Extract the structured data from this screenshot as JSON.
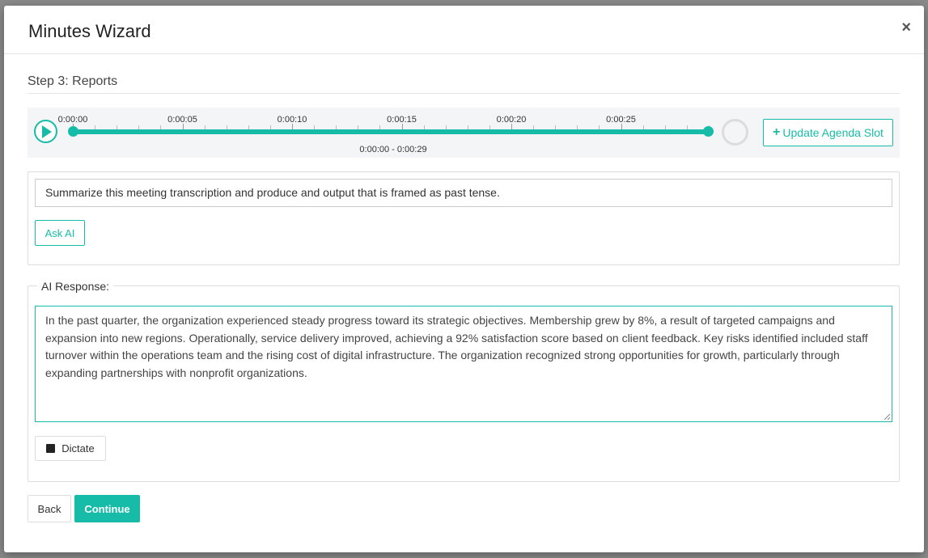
{
  "modal": {
    "title": "Minutes Wizard",
    "close_label": "×"
  },
  "step": {
    "title": "Step 3: Reports"
  },
  "player": {
    "tick_labels": [
      "0:00:00",
      "0:00:05",
      "0:00:10",
      "0:00:15",
      "0:00:20",
      "0:00:25"
    ],
    "range_label": "0:00:00 - 0:00:29",
    "update_button_label": "Update Agenda Slot"
  },
  "prompt": {
    "value": "Summarize this meeting transcription and produce and output that is framed as past tense.",
    "ask_button_label": "Ask AI"
  },
  "response": {
    "legend": "AI Response:",
    "text": "In the past quarter, the organization experienced steady progress toward its strategic objectives. Membership grew by 8%, a result of targeted campaigns and expansion into new regions. Operationally, service delivery improved, achieving a 92% satisfaction score based on client feedback. Key risks identified included staff turnover within the operations team and the rising cost of digital infrastructure. The organization recognized strong opportunities for growth, particularly through expanding partnerships with nonprofit organizations.",
    "dictate_label": "Dictate"
  },
  "footer": {
    "back_label": "Back",
    "continue_label": "Continue"
  },
  "colors": {
    "accent": "#17bca9"
  }
}
